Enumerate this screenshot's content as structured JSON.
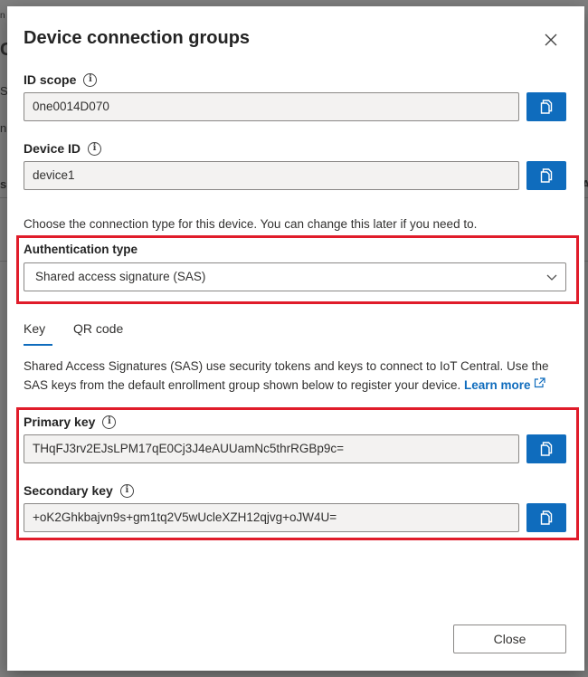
{
  "background": {
    "frag1": "n",
    "frag2": "C",
    "frag3": "S",
    "frag4": "n",
    "frag5": "s",
    "frag6": "A"
  },
  "dialog": {
    "title": "Device connection groups",
    "close_icon": "close-icon",
    "id_scope": {
      "label": "ID scope",
      "value": "0ne0014D070"
    },
    "device_id": {
      "label": "Device ID",
      "value": "device1"
    },
    "connection_hint": "Choose the connection type for this device. You can change this later if you need to.",
    "auth": {
      "label": "Authentication type",
      "selected": "Shared access signature (SAS)"
    },
    "tabs": [
      {
        "label": "Key",
        "active": true
      },
      {
        "label": "QR code",
        "active": false
      }
    ],
    "sas_description": "Shared Access Signatures (SAS) use security tokens and keys to connect to IoT Central. Use the SAS keys from the default enrollment group shown below to register your device.",
    "learn_more": "Learn more",
    "primary_key": {
      "label": "Primary key",
      "value": "THqFJ3rv2EJsLPM17qE0Cj3J4eAUUamNc5thrRGBp9c="
    },
    "secondary_key": {
      "label": "Secondary key",
      "value": "+oK2Ghkbajvn9s+gm1tq2V5wUcleXZH12qjvg+oJW4U="
    },
    "close_label": "Close"
  },
  "colors": {
    "accent": "#0f6cbd",
    "highlight": "#e01c2a"
  }
}
